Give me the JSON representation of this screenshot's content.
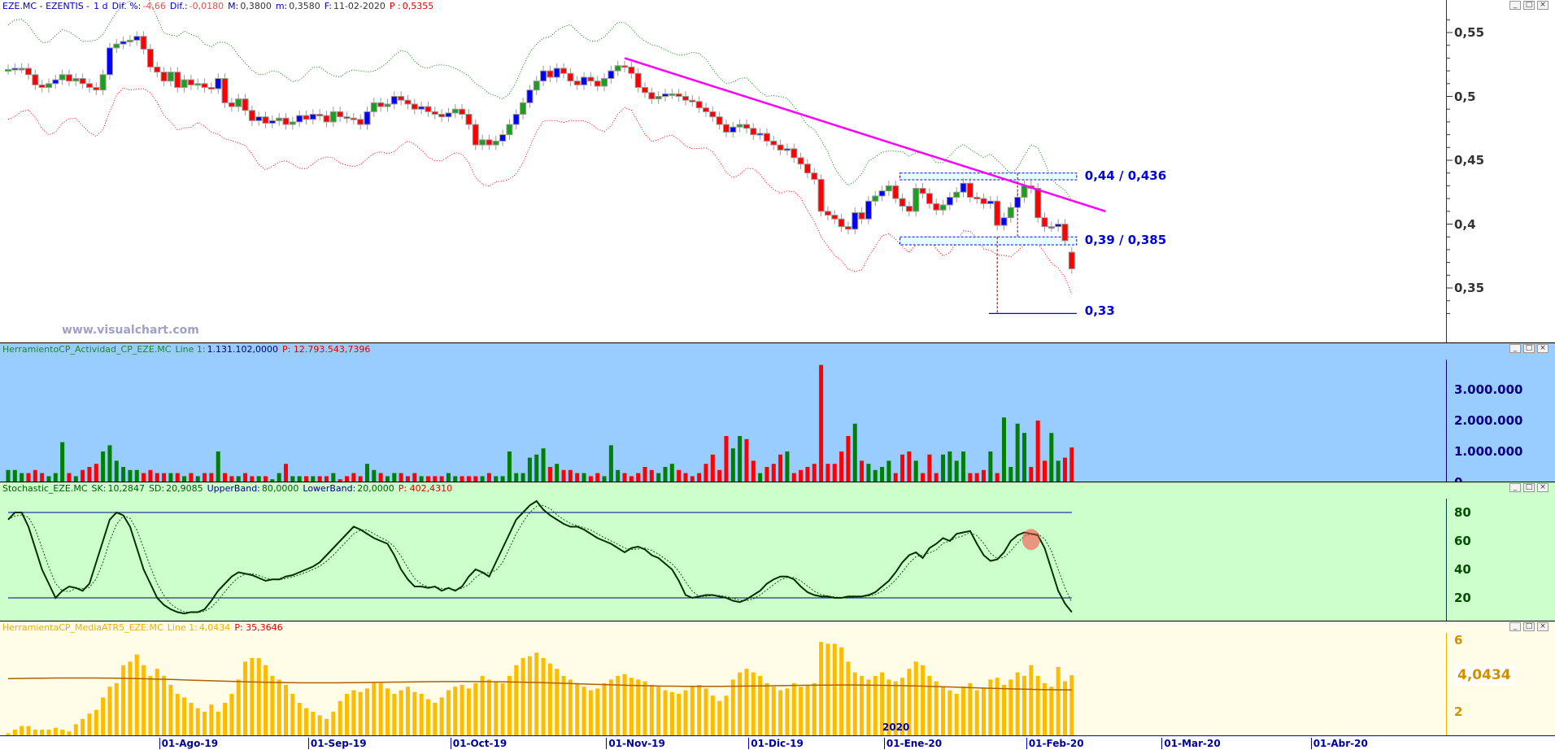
{
  "price_header": {
    "symbol": "EZE.MC - EZENTIS -",
    "period": "1 d",
    "dif_pct_label": "Dif. %:",
    "dif_pct": "-4,66",
    "dif_label": "Dif.:",
    "dif": "-0,0180",
    "max_label": "M:",
    "max": "0,3800",
    "min_label": "m:",
    "min": "0,3580",
    "date_label": "F:",
    "date": "11-02-2020",
    "p_label": "P :",
    "p": "0,5355"
  },
  "volume_header": {
    "name": "HerramientoCP_Actividad_CP_EZE.MC",
    "line_label": "Line 1:",
    "line": "1.131.102,0000",
    "p": "P: 12.793.543,7396"
  },
  "stoch_header": {
    "name": "Stochastic_EZE.MC",
    "sk_label": "SK:",
    "sk": "10,2847",
    "sd_label": "SD:",
    "sd": "20,9085",
    "ub_label": "UpperBand:",
    "ub": "80,0000",
    "lb_label": "LowerBand:",
    "lb": "20,0000",
    "p": "P: 402,4310"
  },
  "atr_header": {
    "name": "HerramientaCP_MediaATR5_EZE.MC",
    "line_label": "Line 1:",
    "line": "4,0434",
    "p": "P: 35,3646"
  },
  "window_buttons": {
    "minimize": "_",
    "maximize": "□",
    "close": "×"
  },
  "watermark": "www.visualchart.com",
  "annotations": {
    "resistance": {
      "label": "0,44 / 0,436",
      "hi": 0.44,
      "lo": 0.436
    },
    "support": {
      "label": "0,39 / 0,385",
      "hi": 0.39,
      "lo": 0.385
    },
    "target": {
      "label": "0,33",
      "value": 0.33
    },
    "trendline": {
      "from_bar": 91,
      "from_price": 0.53,
      "to_bar": 162,
      "to_price": 0.41
    },
    "colors": {
      "trend": "#ff00ff",
      "box": "#0000ff",
      "up": "#1e9e1e",
      "up_alt": "#0000ff",
      "down": "#ff0000"
    }
  },
  "date_axis": {
    "labels": [
      {
        "text": "01-Ago-19",
        "bar": 23
      },
      {
        "text": "01-Sep-19",
        "bar": 45
      },
      {
        "text": "01-Oct-19",
        "bar": 66
      },
      {
        "text": "01-Nov-19",
        "bar": 89
      },
      {
        "text": "01-Dic-19",
        "bar": 110
      },
      {
        "text": "01-Ene-20",
        "bar": 130
      },
      {
        "text": "01-Feb-20",
        "bar": 151
      },
      {
        "text": "01-Mar-20",
        "bar": 171
      },
      {
        "text": "01-Abr-20",
        "bar": 193
      }
    ],
    "year_label": "2020"
  },
  "chart_data": [
    {
      "type": "candlestick",
      "title": "EZE.MC - EZENTIS - 1 d",
      "yticks": [
        "0,55",
        "0,5",
        "0,45",
        "0,4",
        "0,35"
      ],
      "ytick_values": [
        0.55,
        0.5,
        0.45,
        0.4,
        0.35
      ],
      "ylim": [
        0.315,
        0.575
      ],
      "last_open": 0.378,
      "close": [
        0.521,
        0.522,
        0.522,
        0.517,
        0.509,
        0.507,
        0.51,
        0.513,
        0.517,
        0.512,
        0.514,
        0.51,
        0.507,
        0.505,
        0.517,
        0.538,
        0.541,
        0.543,
        0.544,
        0.547,
        0.537,
        0.523,
        0.519,
        0.512,
        0.519,
        0.507,
        0.513,
        0.509,
        0.51,
        0.507,
        0.506,
        0.514,
        0.495,
        0.492,
        0.498,
        0.489,
        0.481,
        0.484,
        0.479,
        0.481,
        0.483,
        0.478,
        0.48,
        0.485,
        0.482,
        0.486,
        0.485,
        0.48,
        0.488,
        0.484,
        0.483,
        0.482,
        0.478,
        0.488,
        0.495,
        0.492,
        0.494,
        0.5,
        0.497,
        0.494,
        0.49,
        0.492,
        0.488,
        0.486,
        0.484,
        0.487,
        0.49,
        0.486,
        0.478,
        0.462,
        0.466,
        0.462,
        0.465,
        0.47,
        0.478,
        0.486,
        0.495,
        0.505,
        0.512,
        0.52,
        0.515,
        0.522,
        0.518,
        0.512,
        0.509,
        0.515,
        0.512,
        0.508,
        0.514,
        0.52,
        0.524,
        0.523,
        0.518,
        0.507,
        0.503,
        0.498,
        0.5,
        0.502,
        0.502,
        0.5,
        0.497,
        0.496,
        0.491,
        0.488,
        0.484,
        0.478,
        0.472,
        0.476,
        0.478,
        0.475,
        0.47,
        0.471,
        0.465,
        0.462,
        0.458,
        0.459,
        0.452,
        0.447,
        0.44,
        0.435,
        0.41,
        0.407,
        0.404,
        0.398,
        0.396,
        0.409,
        0.404,
        0.418,
        0.422,
        0.426,
        0.43,
        0.42,
        0.414,
        0.41,
        0.428,
        0.424,
        0.416,
        0.411,
        0.415,
        0.421,
        0.425,
        0.432,
        0.421,
        0.42,
        0.416,
        0.418,
        0.399,
        0.405,
        0.413,
        0.421,
        0.43,
        0.428,
        0.405,
        0.398,
        0.398,
        0.4,
        0.387,
        0.365
      ],
      "band_offset": 0.035
    },
    {
      "type": "bar",
      "title": "HerramientoCP_Actividad_CP_EZE.MC",
      "yticks": [
        "3.000.000",
        "2.000.000",
        "1.000.000",
        "0"
      ],
      "ytick_values": [
        3000,
        2000,
        1000,
        0
      ],
      "units": "thousands",
      "values": [
        400,
        400,
        300,
        300,
        400,
        300,
        200,
        300,
        1300,
        300,
        200,
        400,
        500,
        600,
        1000,
        1200,
        700,
        500,
        400,
        400,
        300,
        400,
        300,
        300,
        300,
        300,
        200,
        300,
        200,
        300,
        300,
        1000,
        300,
        200,
        200,
        300,
        200,
        200,
        200,
        100,
        300,
        600,
        200,
        200,
        200,
        200,
        200,
        200,
        300,
        100,
        200,
        300,
        200,
        600,
        400,
        300,
        200,
        300,
        300,
        200,
        300,
        200,
        200,
        200,
        200,
        300,
        200,
        200,
        200,
        200,
        200,
        300,
        200,
        200,
        1000,
        300,
        300,
        800,
        900,
        1100,
        500,
        600,
        400,
        400,
        300,
        300,
        200,
        300,
        200,
        1200,
        400,
        300,
        200,
        300,
        500,
        400,
        300,
        500,
        600,
        400,
        300,
        200,
        300,
        600,
        900,
        400,
        1500,
        1100,
        1500,
        1400,
        700,
        300,
        500,
        600,
        900,
        1000,
        300,
        400,
        500,
        600,
        3800,
        600,
        600,
        1000,
        1500,
        1900,
        700,
        600,
        400,
        500,
        700,
        300,
        900,
        1000,
        700,
        300,
        900,
        300,
        900,
        1000,
        700,
        1000,
        300,
        300,
        400,
        1000,
        300,
        2100,
        500,
        1900,
        1600,
        500,
        2000,
        700,
        1600,
        700,
        800,
        1131
      ]
    },
    {
      "type": "line",
      "title": "Stochastic_EZE.MC",
      "yticks": [
        "80",
        "60",
        "40",
        "20"
      ],
      "ytick_values": [
        80,
        60,
        40,
        20
      ],
      "upper_band": 80,
      "lower_band": 20,
      "highlight_bar": 151,
      "sk": [
        75,
        80,
        80,
        70,
        55,
        40,
        30,
        20,
        25,
        28,
        27,
        25,
        30,
        45,
        60,
        75,
        80,
        78,
        70,
        55,
        40,
        30,
        20,
        15,
        12,
        10,
        9,
        10,
        10,
        12,
        18,
        25,
        30,
        35,
        38,
        37,
        36,
        34,
        32,
        33,
        33,
        35,
        36,
        38,
        40,
        42,
        45,
        50,
        55,
        60,
        65,
        70,
        68,
        65,
        62,
        60,
        58,
        50,
        40,
        33,
        28,
        28,
        27,
        28,
        25,
        27,
        25,
        28,
        35,
        40,
        38,
        35,
        45,
        55,
        65,
        75,
        80,
        85,
        88,
        82,
        78,
        75,
        72,
        70,
        70,
        68,
        65,
        62,
        60,
        58,
        55,
        52,
        55,
        56,
        54,
        50,
        48,
        44,
        40,
        32,
        22,
        20,
        21,
        22,
        22,
        21,
        20,
        18,
        17,
        19,
        22,
        25,
        30,
        33,
        35,
        35,
        33,
        28,
        24,
        22,
        21,
        21,
        20,
        20,
        21,
        21,
        21,
        22,
        24,
        28,
        32,
        38,
        45,
        50,
        52,
        48,
        55,
        58,
        62,
        60,
        65,
        66,
        67,
        58,
        50,
        46,
        47,
        52,
        60,
        64,
        66,
        65,
        64,
        55,
        40,
        25,
        16,
        10
      ]
    },
    {
      "type": "bar",
      "title": "HerramientaCP_MediaATR5_EZE.MC",
      "yticks": [
        "6",
        "4,0434",
        "2"
      ],
      "ytick_values": [
        6,
        4.0434,
        2
      ],
      "values": [
        0.8,
        1.0,
        1.2,
        1.2,
        1.0,
        1.0,
        1.0,
        1.1,
        1.0,
        0.9,
        1.3,
        1.6,
        1.9,
        2.1,
        2.8,
        3.4,
        3.6,
        4.6,
        4.8,
        5.2,
        4.6,
        4.0,
        4.4,
        4.0,
        3.5,
        3.0,
        2.8,
        2.5,
        2.2,
        2.0,
        2.4,
        2.0,
        2.5,
        3.0,
        3.8,
        4.8,
        5.0,
        5.0,
        4.6,
        4.0,
        3.8,
        3.5,
        3.0,
        2.5,
        2.2,
        2.0,
        1.8,
        1.6,
        2.0,
        2.6,
        3.0,
        3.2,
        3.1,
        3.3,
        3.6,
        3.6,
        3.3,
        3.0,
        3.2,
        3.4,
        3.1,
        3.0,
        2.7,
        2.5,
        2.8,
        3.2,
        3.4,
        3.5,
        3.3,
        3.6,
        4.0,
        3.8,
        3.7,
        3.6,
        4.0,
        4.6,
        5.0,
        5.1,
        5.3,
        5.0,
        4.7,
        4.4,
        4.0,
        3.8,
        3.6,
        3.4,
        3.2,
        3.3,
        3.6,
        3.8,
        4.0,
        4.1,
        3.9,
        3.8,
        3.7,
        3.5,
        3.4,
        3.2,
        3.1,
        3.0,
        3.2,
        3.4,
        3.5,
        3.3,
        2.9,
        2.6,
        2.9,
        3.8,
        4.2,
        4.4,
        4.2,
        4.0,
        3.6,
        3.4,
        3.2,
        3.3,
        3.6,
        3.4,
        3.5,
        3.6,
        5.9,
        5.8,
        5.8,
        5.6,
        4.8,
        4.2,
        4.0,
        3.8,
        4.0,
        4.2,
        3.8,
        3.7,
        3.9,
        4.4,
        4.8,
        4.6,
        4.0,
        3.7,
        3.4,
        3.2,
        3.0,
        3.4,
        3.6,
        3.2,
        3.3,
        3.8,
        3.9,
        3.5,
        3.8,
        4.2,
        4.0,
        4.6,
        4.0,
        3.6,
        3.4,
        4.5,
        3.7,
        4.04
      ],
      "avg_line_start": 3.85,
      "avg_line_end": 3.3
    }
  ]
}
